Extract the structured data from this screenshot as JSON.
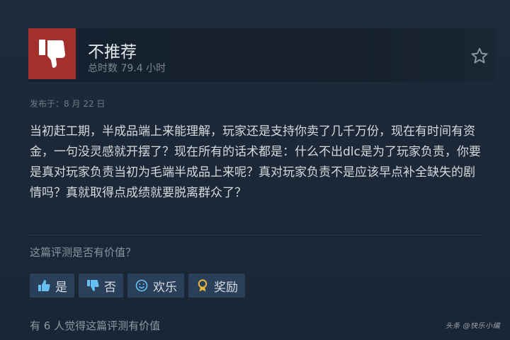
{
  "review": {
    "rating_label": "不推荐",
    "hours": "总时数 79.4 小时",
    "posted": "发布于：8 月 22 日",
    "content": "当初赶工期，半成品端上来能理解，玩家还是支持你卖了几千万份，现在有时间有资金，一句没灵感就开摆了？现在所有的话术都是：什么不出dlc是为了玩家负责，你要是真对玩家负责当初为毛端半成品上来呢？真对玩家负责不是应该早点补全缺失的剧情吗？真就取得点成绩就要脱离群众了？"
  },
  "feedback": {
    "question": "这篇评测是否有价值？",
    "yes_label": "是",
    "no_label": "否",
    "funny_label": "欢乐",
    "award_label": "奖励",
    "summary": "有 6 人觉得这篇评测有价值"
  },
  "watermark": "头条 @快乐小编",
  "icons": {
    "rating": "thumbs-down-icon",
    "favorite": "star-icon",
    "yes": "thumbs-up-icon",
    "no": "thumbs-down-icon",
    "funny": "smiley-icon",
    "award": "award-icon"
  },
  "colors": {
    "background": "#1b2838",
    "not_recommended": "#a3302a",
    "button": "#2a3f5a",
    "accent_blue": "#66c0f4",
    "award_gold": "#e8b938"
  }
}
